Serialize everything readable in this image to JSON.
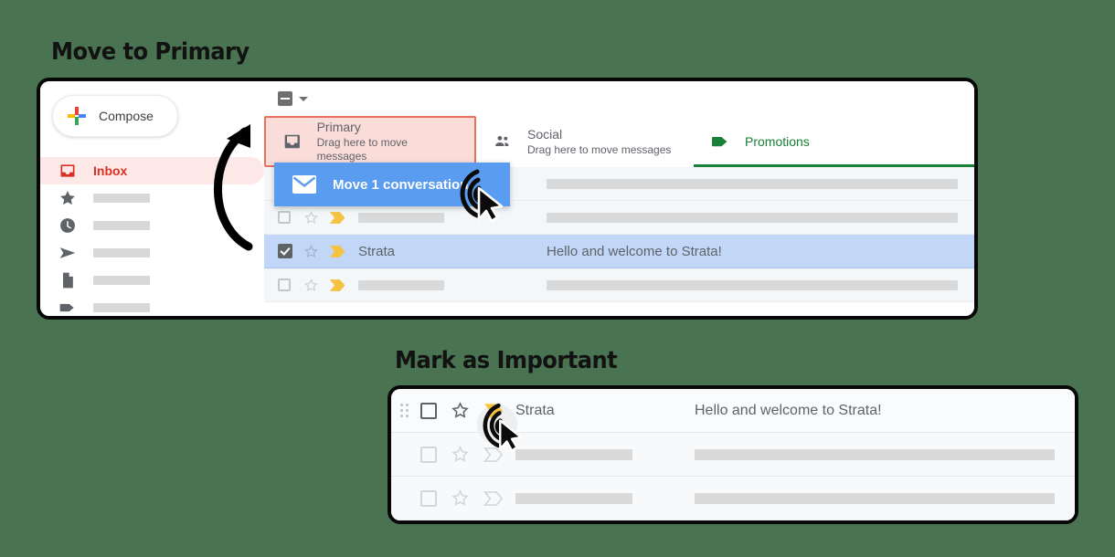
{
  "background_color": "#4a7351",
  "sections": [
    {
      "id": "move-to-primary",
      "title": "Move to Primary"
    },
    {
      "id": "mark-as-important",
      "title": "Mark as Important"
    }
  ],
  "gmail_panel": {
    "sidebar": {
      "compose": {
        "label": "Compose",
        "icon": "google-plus-icon"
      },
      "items": [
        {
          "label": "Inbox",
          "icon": "inbox-icon",
          "active": true,
          "color": "#d93025"
        },
        {
          "label": "",
          "icon": "star-icon",
          "active": false
        },
        {
          "label": "",
          "icon": "clock-icon",
          "active": false
        },
        {
          "label": "",
          "icon": "send-icon",
          "active": false
        },
        {
          "label": "",
          "icon": "draft-file-icon",
          "active": false
        },
        {
          "label": "",
          "icon": "label-tag-icon",
          "active": false
        }
      ]
    },
    "toolbar": {
      "select_all": {
        "icon": "indeterminate-checkbox-icon",
        "state": "indeterminate"
      },
      "select_menu": {
        "icon": "chevron-down-icon"
      }
    },
    "tabs": [
      {
        "id": "primary",
        "label": "Primary",
        "sublabel": "Drag here to move messages",
        "icon": "inbox-tab-icon",
        "highlighted": true,
        "highlight_bg": "#fadcd8",
        "highlight_border": "#e8705e",
        "active": false
      },
      {
        "id": "social",
        "label": "Social",
        "sublabel": "Drag here to move messages",
        "icon": "people-icon",
        "highlighted": false,
        "active": false
      },
      {
        "id": "promotions",
        "label": "Promotions",
        "sublabel": "",
        "icon": "tag-icon",
        "highlighted": false,
        "active": true,
        "accent": "#188038"
      }
    ],
    "drag_chip": {
      "label": "Move 1 conversation",
      "icon": "envelope-icon",
      "color": "#5a9cf0"
    },
    "rows": [
      {
        "checked": false,
        "starred": false,
        "important": true,
        "sender": "",
        "subject": "",
        "placeholder": true,
        "selected": false
      },
      {
        "checked": false,
        "starred": false,
        "important": true,
        "sender": "",
        "subject": "",
        "placeholder": true,
        "selected": false
      },
      {
        "checked": true,
        "starred": false,
        "important": true,
        "sender": "Strata",
        "subject": "Hello and welcome to Strata!",
        "placeholder": false,
        "selected": true
      },
      {
        "checked": false,
        "starred": false,
        "important": true,
        "sender": "",
        "subject": "",
        "placeholder": true,
        "selected": false
      }
    ],
    "cursor": {
      "icon": "click-cursor-icon"
    },
    "arrow": {
      "icon": "curved-arrow-icon"
    }
  },
  "row_panel": {
    "rows": [
      {
        "drag_handle": true,
        "checked": false,
        "starred": false,
        "important": true,
        "important_filled": true,
        "hover": true,
        "sender": "Strata",
        "subject": "Hello and welcome to Strata!",
        "placeholder": false
      },
      {
        "drag_handle": false,
        "checked": false,
        "starred": false,
        "important": true,
        "important_filled": false,
        "hover": false,
        "sender": "",
        "subject": "",
        "placeholder": true
      },
      {
        "drag_handle": false,
        "checked": false,
        "starred": false,
        "important": true,
        "important_filled": false,
        "hover": false,
        "sender": "",
        "subject": "",
        "placeholder": true
      }
    ],
    "cursor": {
      "icon": "click-cursor-icon"
    }
  },
  "colors": {
    "selected_row": "#c2d7f7",
    "important_filled": "#f5c242",
    "important_outline": "#d4d8db",
    "promotions_green": "#188038",
    "inbox_red": "#d93025",
    "chip_blue": "#5a9cf0"
  }
}
